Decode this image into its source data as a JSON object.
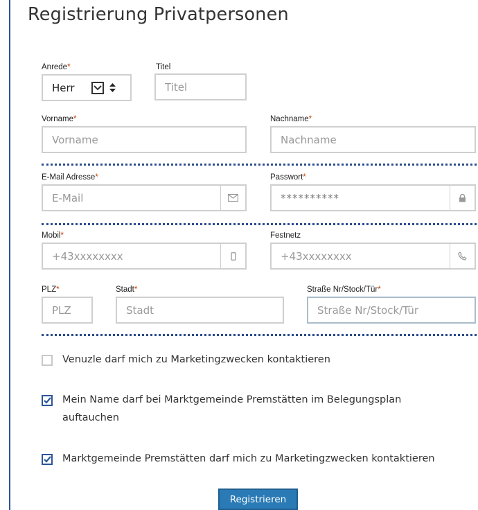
{
  "page_title": "Registrierung Privatpersonen",
  "required_mark": "*",
  "anrede": {
    "label": "Anrede",
    "value": "Herr"
  },
  "titel": {
    "label": "Titel",
    "placeholder": "Titel"
  },
  "vorname": {
    "label": "Vorname",
    "placeholder": "Vorname"
  },
  "nachname": {
    "label": "Nachname",
    "placeholder": "Nachname"
  },
  "email": {
    "label": "E-Mail Adresse",
    "placeholder": "E-Mail",
    "icon": "envelope-icon"
  },
  "passwort": {
    "label": "Passwort",
    "value": "**********",
    "icon": "lock-icon"
  },
  "mobil": {
    "label": "Mobil",
    "placeholder": "+43xxxxxxxx",
    "icon": "mobile-phone-icon"
  },
  "festnetz": {
    "label": "Festnetz",
    "placeholder": "+43xxxxxxxx",
    "icon": "phone-icon"
  },
  "plz": {
    "label": "PLZ",
    "placeholder": "PLZ"
  },
  "stadt": {
    "label": "Stadt",
    "placeholder": "Stadt"
  },
  "strasse": {
    "label": "Straße Nr/Stock/Tür",
    "placeholder": "Straße Nr/Stock/Tür"
  },
  "consents": [
    {
      "label": "Venuzle darf mich zu Marketingzwecken kontaktieren",
      "checked": false
    },
    {
      "label": "Mein Name darf bei Marktgemeinde Premstätten im Belegungsplan auftauchen",
      "checked": true
    },
    {
      "label": "Marktgemeinde Premstätten darf mich zu Marketingzwecken kontaktieren",
      "checked": true
    }
  ],
  "submit_label": "Registrieren",
  "colors": {
    "accent": "#2b5599",
    "button": "#2a7ab5",
    "required": "#c83c00",
    "separator": "#2b4c8c"
  }
}
